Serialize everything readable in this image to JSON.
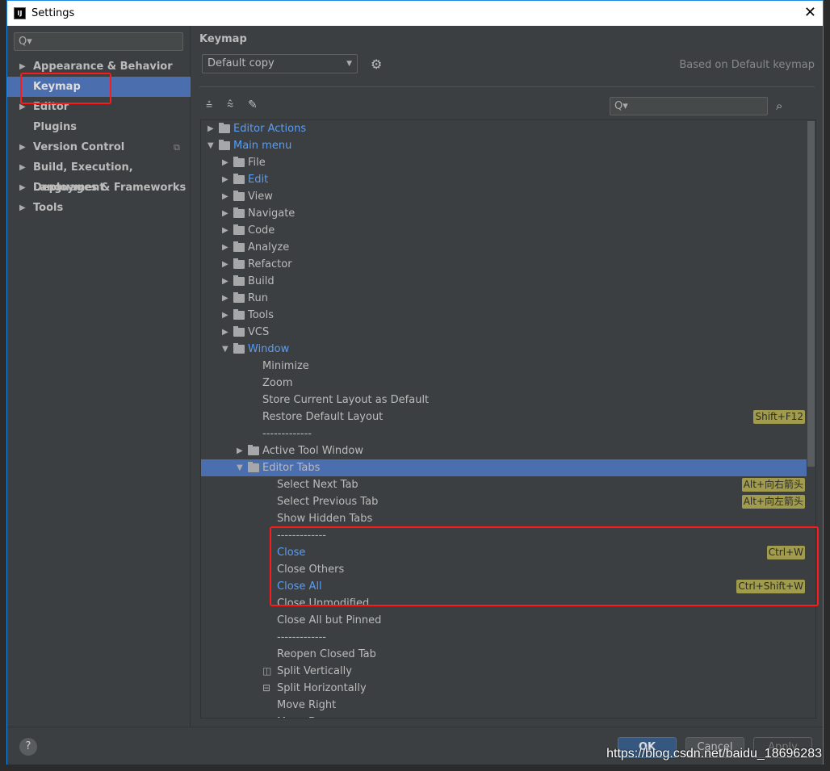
{
  "window": {
    "title": "Settings",
    "logo": "IJ",
    "close": "✕"
  },
  "sidebar": {
    "search_placeholder": "Q▾",
    "items": [
      {
        "label": "Appearance & Behavior",
        "arrow": true
      },
      {
        "label": "Keymap",
        "selected": true
      },
      {
        "label": "Editor",
        "arrow": true
      },
      {
        "label": "Plugins"
      },
      {
        "label": "Version Control",
        "arrow": true,
        "copy_icon": true
      },
      {
        "label": "Build, Execution, Deployment",
        "arrow": true
      },
      {
        "label": "Languages & Frameworks",
        "arrow": true
      },
      {
        "label": "Tools",
        "arrow": true
      }
    ]
  },
  "main": {
    "title": "Keymap",
    "keymap_select": "Default copy",
    "based_on": "Based on Default keymap",
    "search_placeholder": "Q▾"
  },
  "tree": [
    {
      "level": 0,
      "folder": true,
      "expanded": false,
      "label": "Editor Actions",
      "blue": true
    },
    {
      "level": 0,
      "folder": true,
      "expanded": true,
      "label": "Main menu",
      "blue": true
    },
    {
      "level": 1,
      "folder": true,
      "expanded": false,
      "label": "File"
    },
    {
      "level": 1,
      "folder": true,
      "expanded": false,
      "label": "Edit",
      "blue": true
    },
    {
      "level": 1,
      "folder": true,
      "expanded": false,
      "label": "View"
    },
    {
      "level": 1,
      "folder": true,
      "expanded": false,
      "label": "Navigate"
    },
    {
      "level": 1,
      "folder": true,
      "expanded": false,
      "label": "Code"
    },
    {
      "level": 1,
      "folder": true,
      "expanded": false,
      "label": "Analyze"
    },
    {
      "level": 1,
      "folder": true,
      "expanded": false,
      "label": "Refactor"
    },
    {
      "level": 1,
      "folder": true,
      "expanded": false,
      "label": "Build"
    },
    {
      "level": 1,
      "folder": true,
      "expanded": false,
      "label": "Run"
    },
    {
      "level": 1,
      "folder": true,
      "expanded": false,
      "label": "Tools"
    },
    {
      "level": 1,
      "folder": true,
      "expanded": false,
      "label": "VCS"
    },
    {
      "level": 1,
      "folder": true,
      "expanded": true,
      "label": "Window",
      "blue": true
    },
    {
      "level": 2,
      "label": "Minimize"
    },
    {
      "level": 2,
      "label": "Zoom"
    },
    {
      "level": 2,
      "label": "Store Current Layout as Default"
    },
    {
      "level": 2,
      "label": "Restore Default Layout",
      "shortcut": "Shift+F12"
    },
    {
      "level": 2,
      "label": "-------------"
    },
    {
      "level": 2,
      "folder": true,
      "expanded": false,
      "label": "Active Tool Window"
    },
    {
      "level": 2,
      "folder": true,
      "expanded": true,
      "label": "Editor Tabs",
      "selected": true
    },
    {
      "level": 3,
      "label": "Select Next Tab",
      "shortcut": "Alt+向右箭头"
    },
    {
      "level": 3,
      "label": "Select Previous Tab",
      "shortcut": "Alt+向左箭头"
    },
    {
      "level": 3,
      "label": "Show Hidden Tabs"
    },
    {
      "level": 3,
      "label": "-------------"
    },
    {
      "level": 3,
      "label": "Close",
      "blue": true,
      "shortcut": "Ctrl+W"
    },
    {
      "level": 3,
      "label": "Close Others"
    },
    {
      "level": 3,
      "label": "Close All",
      "blue": true,
      "shortcut": "Ctrl+Shift+W"
    },
    {
      "level": 3,
      "label": "Close Unmodified"
    },
    {
      "level": 3,
      "label": "Close All but Pinned"
    },
    {
      "level": 3,
      "label": "-------------"
    },
    {
      "level": 3,
      "label": "Reopen Closed Tab"
    },
    {
      "level": 3,
      "label": "Split Vertically",
      "icon": "split-vertically-icon",
      "glyph": "◫"
    },
    {
      "level": 3,
      "label": "Split Horizontally",
      "icon": "split-horizontally-icon",
      "glyph": "⊟"
    },
    {
      "level": 3,
      "label": "Move Right"
    },
    {
      "level": 3,
      "label": "Move Down"
    }
  ],
  "footer": {
    "help": "?",
    "ok": "OK",
    "cancel": "Cancel",
    "apply": "Apply"
  },
  "watermark": "https://blog.csdn.net/baidu_18696283",
  "colors": {
    "selection": "#4b6eaf",
    "link": "#589df6",
    "shortcut_bg": "#a09b4d",
    "highlight_box": "#ff1a1a"
  }
}
